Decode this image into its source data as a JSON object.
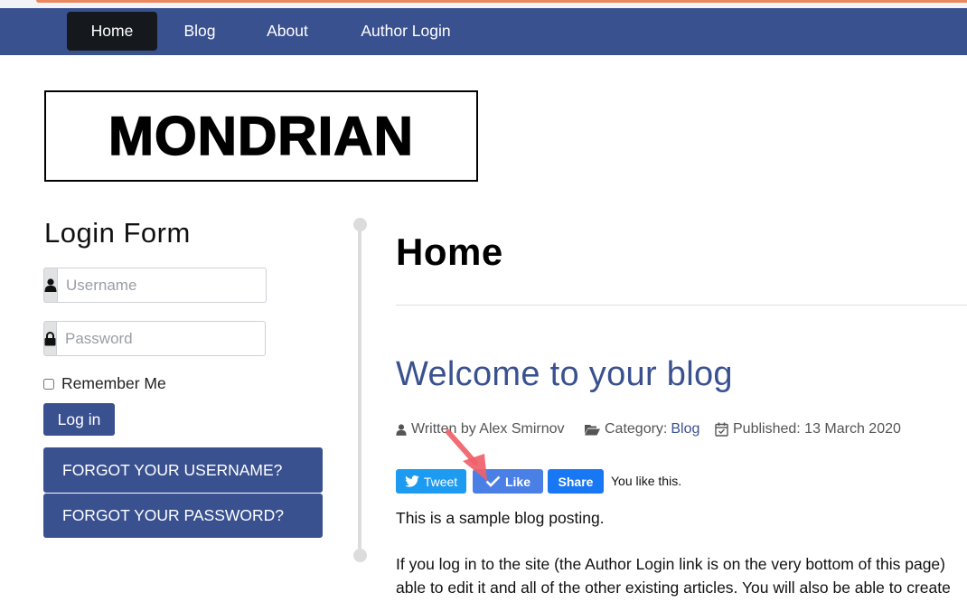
{
  "nav": {
    "items": [
      {
        "label": "Home",
        "active": true
      },
      {
        "label": "Blog",
        "active": false
      },
      {
        "label": "About",
        "active": false
      },
      {
        "label": "Author Login",
        "active": false
      }
    ]
  },
  "logo": {
    "text": "MONDRIAN"
  },
  "login": {
    "title": "Login Form",
    "username": {
      "value": "",
      "placeholder": "Username",
      "icon": "user-icon"
    },
    "password": {
      "value": "",
      "placeholder": "Password",
      "icon": "lock-icon"
    },
    "remember_label": "Remember Me",
    "remember_checked": false,
    "submit_label": "Log in",
    "forgot_username_label": "FORGOT YOUR USERNAME?",
    "forgot_password_label": "FORGOT YOUR PASSWORD?"
  },
  "main": {
    "page_title": "Home",
    "article": {
      "title": "Welcome to your blog",
      "meta": {
        "author": "Written by Alex Smirnov",
        "category_label": "Category:",
        "category_value": "Blog",
        "published": "Published: 13 March 2020"
      },
      "social": {
        "tweet_label": "Tweet",
        "like_label": "Like",
        "share_label": "Share",
        "like_status": "You like this."
      },
      "paragraphs": [
        "This is a sample blog posting.",
        "If you log in to the site (the Author Login link is on the very bottom of this page)",
        "able to edit it and all of the other existing articles. You will also be able to create"
      ]
    }
  },
  "colors": {
    "brand": "#3a5190",
    "nav_active": "#15191d",
    "tweet": "#1d9bf0",
    "like": "#4a7fe6",
    "share": "#1877f2",
    "annotation_arrow": "#f0616a"
  }
}
